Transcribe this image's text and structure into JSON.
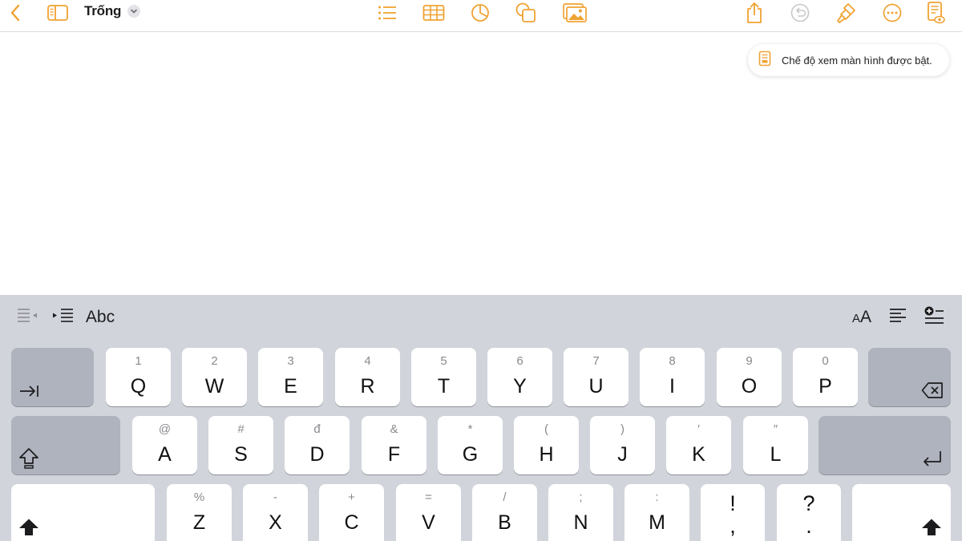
{
  "toolbar": {
    "back_icon": "chevron-left-icon",
    "sidebar_icon": "sidebar-icon",
    "title": "Trống",
    "title_menu_icon": "chevron-down-icon",
    "center_icons": [
      "list-icon",
      "table-icon",
      "chart-icon",
      "shape-icon",
      "media-icon"
    ],
    "right_icons": [
      "share-icon",
      "undo-icon",
      "format-brush-icon",
      "more-icon",
      "reading-view-icon"
    ],
    "accent": "#f0a232"
  },
  "toast": {
    "icon": "reading-view-icon",
    "text": "Chế độ xem màn hình được bật."
  },
  "keyboard": {
    "shortcut_bar": {
      "left": [
        "outdent-icon",
        "indent-icon"
      ],
      "style_label": "Abc",
      "right_text": "AA",
      "right_icons": [
        "align-icon",
        "insert-icon"
      ]
    },
    "row1": [
      {
        "sec": "1",
        "pri": "Q"
      },
      {
        "sec": "2",
        "pri": "W"
      },
      {
        "sec": "3",
        "pri": "E"
      },
      {
        "sec": "4",
        "pri": "R"
      },
      {
        "sec": "5",
        "pri": "T"
      },
      {
        "sec": "6",
        "pri": "Y"
      },
      {
        "sec": "7",
        "pri": "U"
      },
      {
        "sec": "8",
        "pri": "I"
      },
      {
        "sec": "9",
        "pri": "O"
      },
      {
        "sec": "0",
        "pri": "P"
      }
    ],
    "row2": [
      {
        "sec": "@",
        "pri": "A"
      },
      {
        "sec": "#",
        "pri": "S"
      },
      {
        "sec": "đ",
        "pri": "D"
      },
      {
        "sec": "&",
        "pri": "F"
      },
      {
        "sec": "*",
        "pri": "G"
      },
      {
        "sec": "(",
        "pri": "H"
      },
      {
        "sec": ")",
        "pri": "J"
      },
      {
        "sec": "′",
        "pri": "K"
      },
      {
        "sec": "″",
        "pri": "L"
      }
    ],
    "row3": [
      {
        "sec": "%",
        "pri": "Z"
      },
      {
        "sec": "-",
        "pri": "X"
      },
      {
        "sec": "+",
        "pri": "C"
      },
      {
        "sec": "=",
        "pri": "V"
      },
      {
        "sec": "/",
        "pri": "B"
      },
      {
        "sec": ";",
        "pri": "N"
      },
      {
        "sec": ":",
        "pri": "M"
      }
    ],
    "punct_keys": [
      {
        "top": "!",
        "bottom": ","
      },
      {
        "top": "?",
        "bottom": "."
      }
    ]
  }
}
